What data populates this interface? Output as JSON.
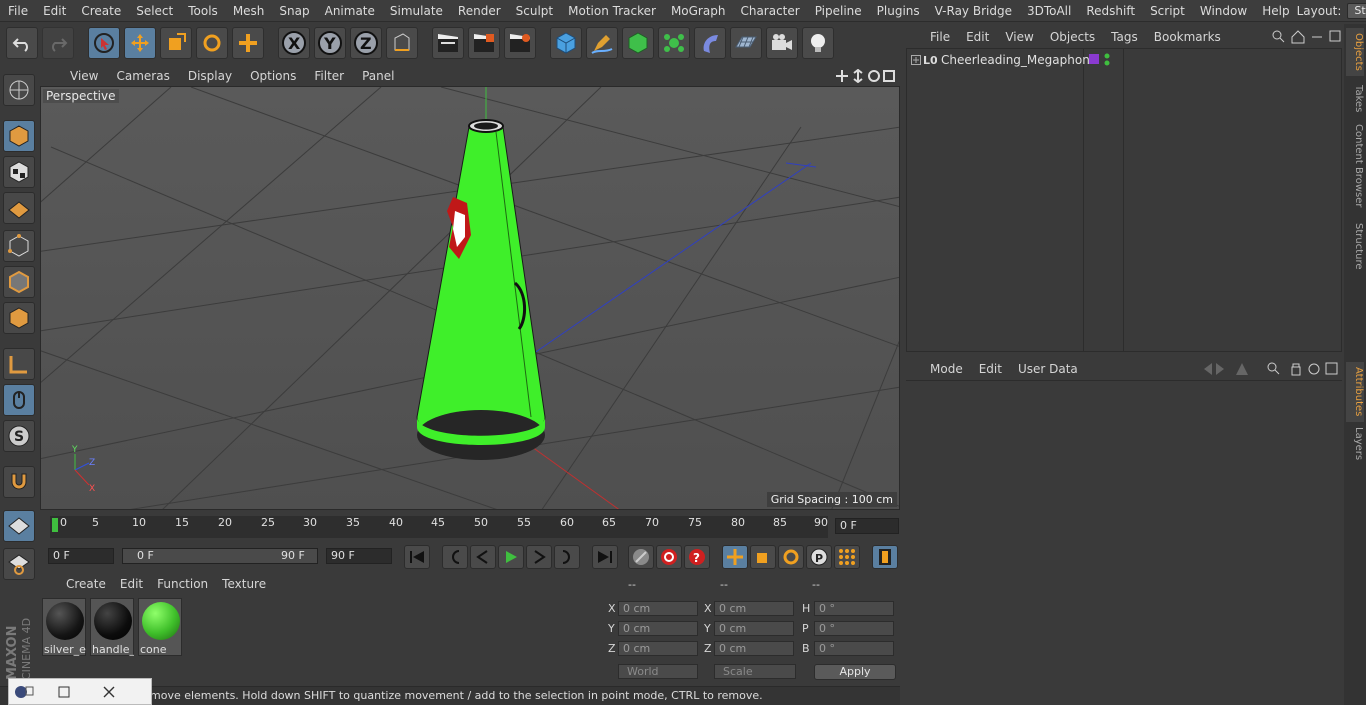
{
  "menubar": {
    "items": [
      "File",
      "Edit",
      "Create",
      "Select",
      "Tools",
      "Mesh",
      "Snap",
      "Animate",
      "Simulate",
      "Render",
      "Sculpt",
      "Motion Tracker",
      "MoGraph",
      "Character",
      "Pipeline",
      "Plugins",
      "V-Ray Bridge",
      "3DToAll",
      "Redshift",
      "Script",
      "Window",
      "Help"
    ],
    "layout_label": "Layout:",
    "layout_value": "Startup"
  },
  "viewport": {
    "menu": [
      "View",
      "Cameras",
      "Display",
      "Options",
      "Filter",
      "Panel"
    ],
    "camera_label": "Perspective",
    "grid_spacing": "Grid Spacing : 100 cm"
  },
  "timeline": {
    "ticks": [
      "0",
      "5",
      "10",
      "15",
      "20",
      "25",
      "30",
      "35",
      "40",
      "45",
      "50",
      "55",
      "60",
      "65",
      "70",
      "75",
      "80",
      "85",
      "90"
    ],
    "current_frame": "0 F"
  },
  "transport": {
    "start_field": "0 F",
    "range_start": "0 F",
    "range_end": "90 F",
    "end_field": "90 F"
  },
  "materials": {
    "menu": [
      "Create",
      "Edit",
      "Function",
      "Texture"
    ],
    "items": [
      {
        "name": "silver_ec",
        "color": "#151515"
      },
      {
        "name": "handle_",
        "color": "#0c0c0c"
      },
      {
        "name": "cone",
        "color": "#3fbf2a"
      }
    ]
  },
  "coordinates": {
    "headers": [
      "--",
      "--",
      "--"
    ],
    "rows": [
      {
        "a_label": "X",
        "a_val": "0 cm",
        "b_label": "X",
        "b_val": "0 cm",
        "c_label": "H",
        "c_val": "0 °"
      },
      {
        "a_label": "Y",
        "a_val": "0 cm",
        "b_label": "Y",
        "b_val": "0 cm",
        "c_label": "P",
        "c_val": "0 °"
      },
      {
        "a_label": "Z",
        "a_val": "0 cm",
        "b_label": "Z",
        "b_val": "0 cm",
        "c_label": "B",
        "c_val": "0 °"
      }
    ],
    "world": "World",
    "scale": "Scale",
    "apply": "Apply"
  },
  "status": {
    "text": "move elements. Hold down SHIFT to quantize movement / add to the selection in point mode, CTRL to remove."
  },
  "objects": {
    "menu": [
      "File",
      "Edit",
      "View",
      "Objects",
      "Tags",
      "Bookmarks"
    ],
    "items": [
      {
        "name": "Cheerleading_Megaphone"
      }
    ]
  },
  "attributes": {
    "menu": [
      "Mode",
      "Edit",
      "User Data"
    ]
  },
  "right_tabs": [
    "Objects",
    "Takes",
    "Content Browser",
    "Structure",
    "Attributes",
    "Layers"
  ],
  "logo": {
    "brand": "MAXON",
    "product": "CINEMA 4D"
  }
}
